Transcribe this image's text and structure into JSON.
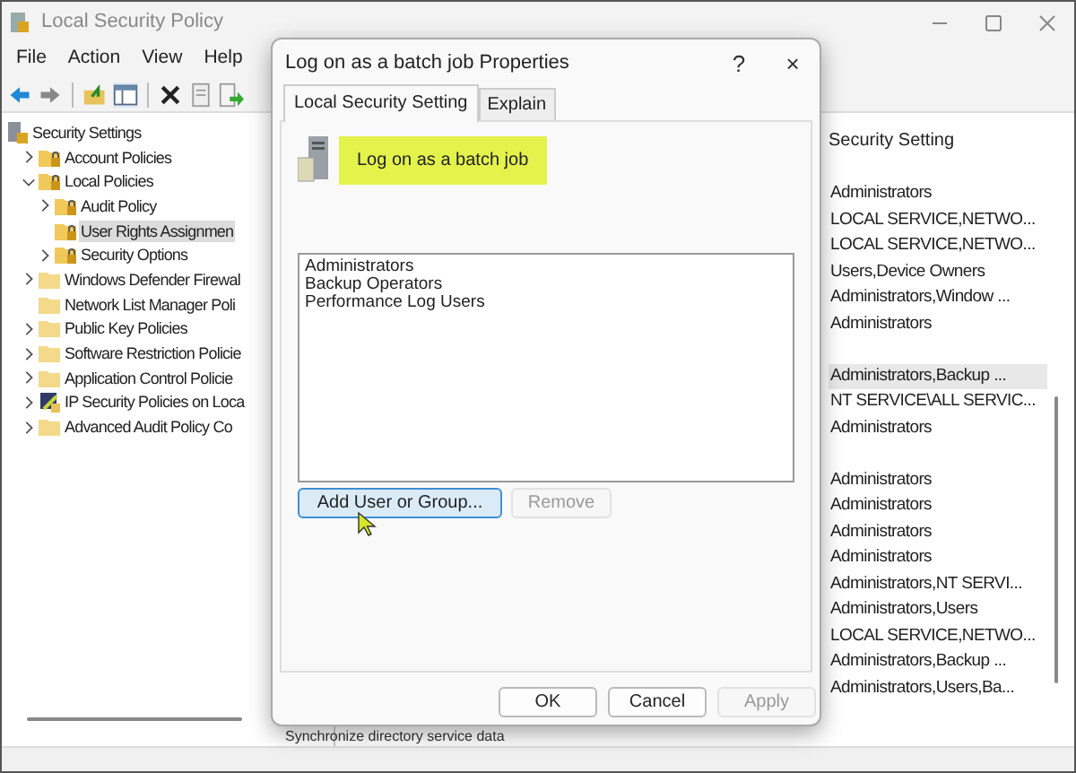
{
  "window": {
    "title": "Local Security Policy"
  },
  "menu": [
    "File",
    "Action",
    "View",
    "Help"
  ],
  "toolbar": [
    {
      "kind": "back"
    },
    {
      "kind": "forward"
    },
    {
      "kind": "sep"
    },
    {
      "kind": "up"
    },
    {
      "kind": "tree"
    },
    {
      "kind": "sep"
    },
    {
      "kind": "delete"
    },
    {
      "kind": "properties"
    },
    {
      "kind": "export"
    }
  ],
  "tree": [
    {
      "label": "Security Settings",
      "kind": "root",
      "selected": false,
      "children": [
        {
          "label": "Account Policies",
          "kind": "locked-folder",
          "expanded": false,
          "selected": false
        },
        {
          "label": "Local Policies",
          "kind": "locked-folder",
          "expanded": true,
          "selected": false,
          "children": [
            {
              "label": "Audit Policy",
              "kind": "locked-folder",
              "expanded": false,
              "selected": false
            },
            {
              "label": "User Rights Assignmen",
              "kind": "locked-folder",
              "selected": true
            },
            {
              "label": "Security Options",
              "kind": "locked-folder",
              "expanded": false,
              "selected": false
            }
          ]
        },
        {
          "label": "Windows Defender Firewal",
          "kind": "folder",
          "expanded": false,
          "selected": false
        },
        {
          "label": "Network List Manager Poli",
          "kind": "folder",
          "selected": false
        },
        {
          "label": "Public Key Policies",
          "kind": "folder",
          "expanded": false,
          "selected": false
        },
        {
          "label": "Software Restriction Policie",
          "kind": "folder",
          "expanded": false,
          "selected": false
        },
        {
          "label": "Application Control Policie",
          "kind": "folder",
          "expanded": false,
          "selected": false
        },
        {
          "label": "IP Security Policies on Loca",
          "kind": "shield",
          "expanded": false,
          "selected": false
        },
        {
          "label": "Advanced Audit Policy Co",
          "kind": "folder",
          "expanded": false,
          "selected": false
        }
      ]
    }
  ],
  "list": {
    "column": "Security Setting",
    "rows": [
      {
        "setting": "Administrators",
        "selected": false
      },
      {
        "setting": "LOCAL SERVICE,NETWO...",
        "selected": false
      },
      {
        "setting": "LOCAL SERVICE,NETWO...",
        "selected": false
      },
      {
        "setting": "Users,Device Owners",
        "selected": false
      },
      {
        "setting": "Administrators,Window ...",
        "selected": false
      },
      {
        "setting": "Administrators",
        "selected": false
      },
      {
        "selected": false
      },
      {
        "setting": "Administrators,Backup ...",
        "selected": true
      },
      {
        "setting": "NT SERVICE\\ALL SERVIC...",
        "selected": false
      },
      {
        "setting": "Administrators",
        "selected": false
      },
      {
        "selected": false
      },
      {
        "setting": "Administrators",
        "selected": false
      },
      {
        "setting": "Administrators",
        "selected": false
      },
      {
        "setting": "Administrators",
        "selected": false
      },
      {
        "setting": "Administrators",
        "selected": false
      },
      {
        "setting": "Administrators,NT SERVI...",
        "selected": false
      },
      {
        "setting": "Administrators,Users",
        "selected": false
      },
      {
        "setting": "LOCAL SERVICE,NETWO...",
        "selected": false
      },
      {
        "setting": "Administrators,Backup ...",
        "selected": false
      },
      {
        "setting": "Administrators,Users,Ba...",
        "selected": false
      }
    ],
    "hidden_row": "Synchronize directory service data"
  },
  "dialog": {
    "title": "Log on as a batch job Properties",
    "help": "?",
    "close": "×",
    "tabs": [
      {
        "label": "Local Security Setting",
        "selected": true
      },
      {
        "label": "Explain",
        "selected": false
      }
    ],
    "policy": "Log on as a batch job",
    "members": [
      {
        "label": "Administrators",
        "selected": false
      },
      {
        "label": "Backup Operators",
        "selected": false
      },
      {
        "label": "Performance Log Users",
        "selected": false
      }
    ],
    "actions": [
      {
        "label": "Add User or Group...",
        "focused": true,
        "disabled": false
      },
      {
        "label": "Remove",
        "focused": false,
        "disabled": true
      }
    ],
    "footer": [
      {
        "label": "OK",
        "disabled": false
      },
      {
        "label": "Cancel",
        "disabled": false
      },
      {
        "label": "Apply",
        "disabled": true
      }
    ]
  }
}
